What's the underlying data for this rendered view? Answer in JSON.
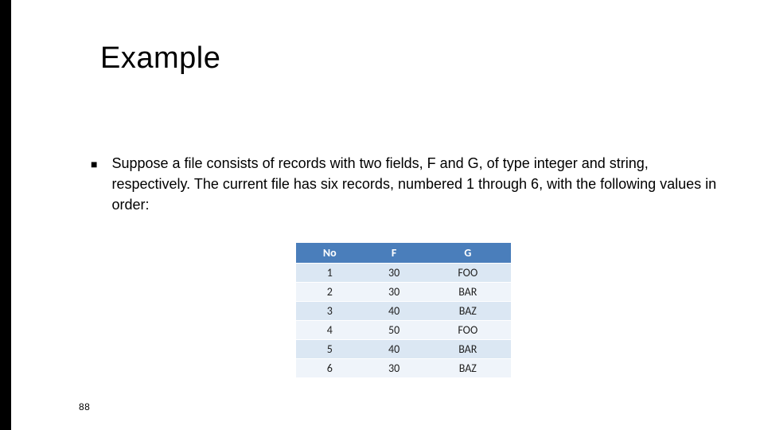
{
  "title": "Example",
  "bullet": {
    "text": "Suppose a file consists of records with two fields, F and G, of type integer and string, respectively. The current file has six records, numbered 1 through 6, with the following values in order:"
  },
  "table": {
    "headers": [
      "No",
      "F",
      "G"
    ],
    "rows": [
      [
        "1",
        "30",
        "FOO"
      ],
      [
        "2",
        "30",
        "BAR"
      ],
      [
        "3",
        "40",
        "BAZ"
      ],
      [
        "4",
        "50",
        "FOO"
      ],
      [
        "5",
        "40",
        "BAR"
      ],
      [
        "6",
        "30",
        "BAZ"
      ]
    ]
  },
  "page_number": "88",
  "chart_data": {
    "type": "table",
    "title": "Example",
    "columns": [
      "No",
      "F",
      "G"
    ],
    "rows": [
      {
        "No": 1,
        "F": 30,
        "G": "FOO"
      },
      {
        "No": 2,
        "F": 30,
        "G": "BAR"
      },
      {
        "No": 3,
        "F": 40,
        "G": "BAZ"
      },
      {
        "No": 4,
        "F": 50,
        "G": "FOO"
      },
      {
        "No": 5,
        "F": 40,
        "G": "BAR"
      },
      {
        "No": 6,
        "F": 30,
        "G": "BAZ"
      }
    ]
  }
}
